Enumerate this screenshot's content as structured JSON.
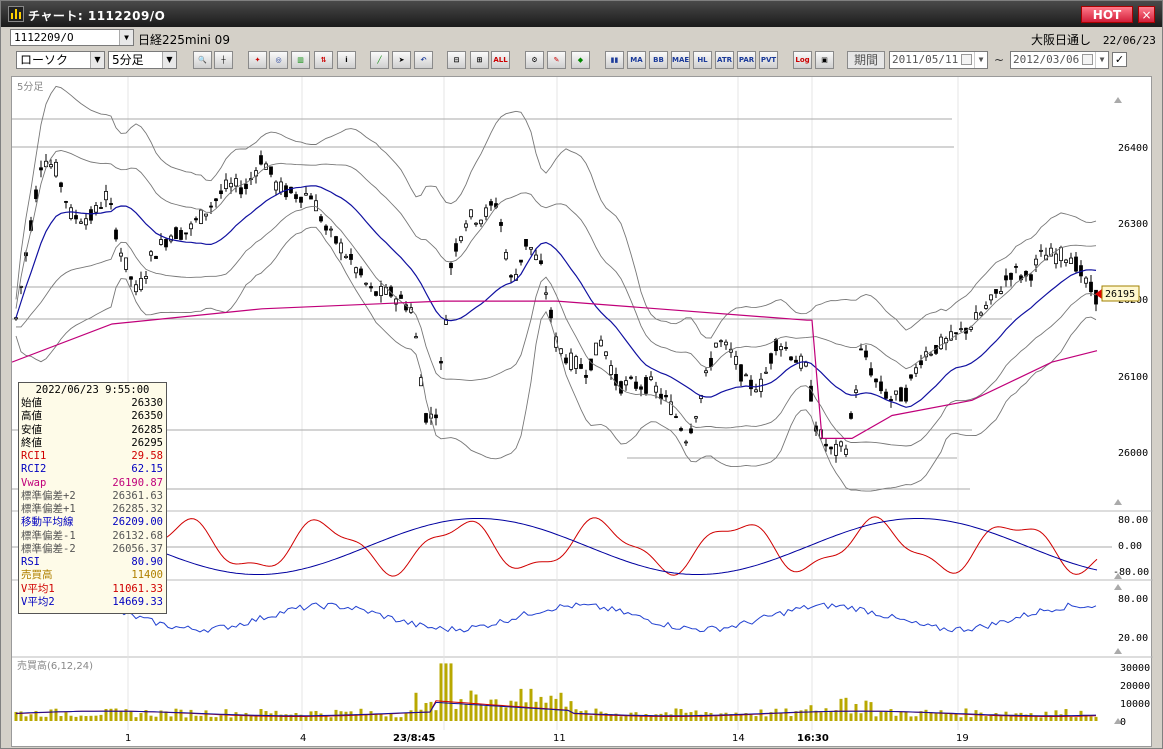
{
  "window": {
    "title": "チャート: 1112209/O",
    "hot_label": "HOT",
    "close_label": "×"
  },
  "toolbar": {
    "symbol_code": "1112209/O",
    "symbol_name": "日経225mini 09",
    "market": "大阪日通し",
    "market_date": "22/06/23",
    "chart_type": "ローソク",
    "interval": "5分足",
    "period_label": "期間",
    "date_from": "2011/05/11",
    "date_to": "2012/03/06",
    "tilde": "~",
    "indicator_buttons": [
      "MA",
      "BB",
      "MAE",
      "HL",
      "ATR",
      "PAR",
      "PVT",
      "Log"
    ]
  },
  "chart": {
    "panel_label": "5分足",
    "volume_panel_label": "売買高(6,12,24)",
    "last_price_label": "26195",
    "price_axis": [
      "26400",
      "26300",
      "26200",
      "26100",
      "26000"
    ],
    "osc_axis": [
      "80.00",
      "0.00",
      "-80.00"
    ],
    "rsi_axis": [
      "80.00",
      "20.00"
    ],
    "vol_axis": [
      "30000",
      "20000",
      "10000",
      "0"
    ],
    "x_labels": [
      "1",
      "4",
      "23/8:45",
      "11",
      "14",
      "16:30",
      "19"
    ]
  },
  "info": {
    "timestamp": "2022/06/23 9:55:00",
    "rows": [
      {
        "label": "始値",
        "value": "26330",
        "color": "#000000"
      },
      {
        "label": "高値",
        "value": "26350",
        "color": "#000000"
      },
      {
        "label": "安値",
        "value": "26285",
        "color": "#000000"
      },
      {
        "label": "終値",
        "value": "26295",
        "color": "#000000"
      },
      {
        "label": "RCI1",
        "value": "29.58",
        "color": "#d00000"
      },
      {
        "label": "RCI2",
        "value": "62.15",
        "color": "#0000c0"
      },
      {
        "label": "Vwap",
        "value": "26190.87",
        "color": "#c0007a"
      },
      {
        "label": "標準偏差+2",
        "value": "26361.63",
        "color": "#555555"
      },
      {
        "label": "標準偏差+1",
        "value": "26285.32",
        "color": "#555555"
      },
      {
        "label": "移動平均線",
        "value": "26209.00",
        "color": "#0000c0"
      },
      {
        "label": "標準偏差-1",
        "value": "26132.68",
        "color": "#555555"
      },
      {
        "label": "標準偏差-2",
        "value": "26056.37",
        "color": "#555555"
      },
      {
        "label": "RSI",
        "value": "80.90",
        "color": "#0000c0"
      },
      {
        "label": "売買高",
        "value": "11400",
        "color": "#b08000"
      },
      {
        "label": "V平均1",
        "value": "11061.33",
        "color": "#d00000"
      },
      {
        "label": "V平均2",
        "value": "14669.33",
        "color": "#0000c0"
      }
    ]
  }
}
